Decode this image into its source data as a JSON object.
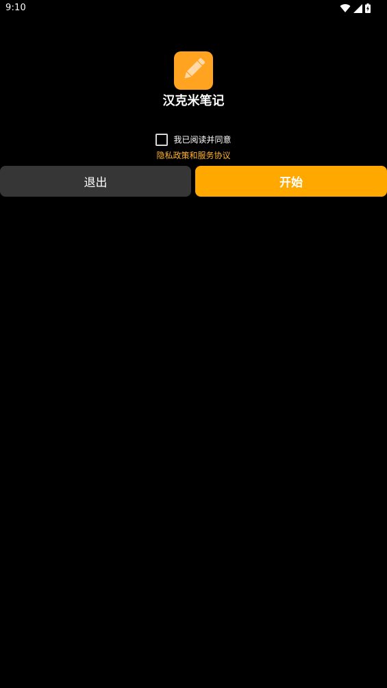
{
  "status_bar": {
    "time": "9:10",
    "icons": [
      "wifi-icon",
      "cellular-signal-icon",
      "battery-charging-icon"
    ]
  },
  "app": {
    "icon": "pencil-icon",
    "icon_bg_color": "#ffa320",
    "name": "汉克米笔记"
  },
  "agreement": {
    "checked": false,
    "label": "我已阅读并同意",
    "link_text": "隐私政策和服务协议",
    "link_color": "#ffb32b"
  },
  "actions": {
    "exit_label": "退出",
    "start_label": "开始",
    "exit_bg": "#363636",
    "start_bg": "#ffa800"
  }
}
